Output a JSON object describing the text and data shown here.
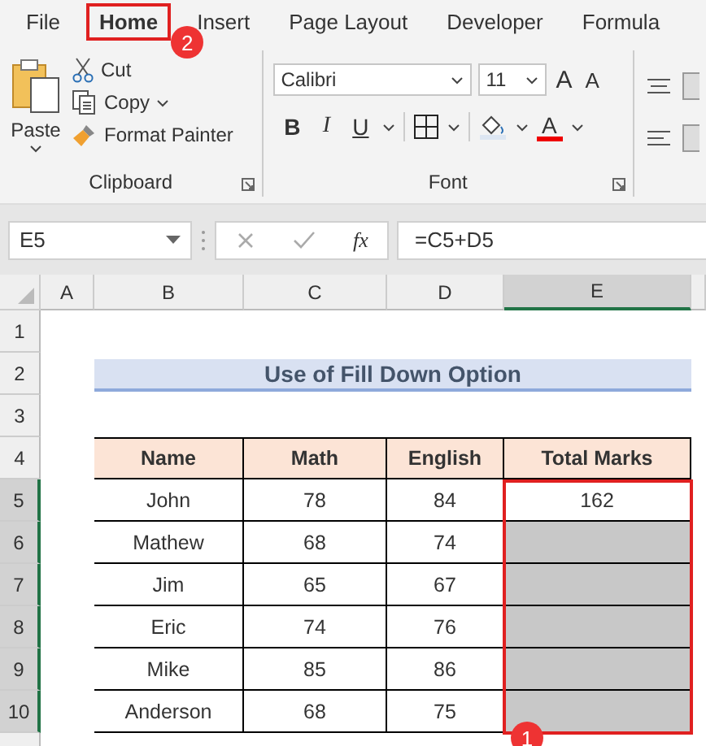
{
  "tabs": [
    {
      "label": "File",
      "selected": false
    },
    {
      "label": "Home",
      "selected": true
    },
    {
      "label": "Insert",
      "selected": false
    },
    {
      "label": "Page Layout",
      "selected": false
    },
    {
      "label": "Developer",
      "selected": false
    },
    {
      "label": "Formula",
      "selected": false
    }
  ],
  "tab_badge": "2",
  "clipboard": {
    "paste": "Paste",
    "items": [
      {
        "label": "Cut",
        "kind": "cut"
      },
      {
        "label": "Copy",
        "kind": "copy"
      },
      {
        "label": "Format Painter",
        "kind": "painter"
      }
    ],
    "group_label": "Clipboard"
  },
  "font": {
    "name": "Calibri",
    "size": "11",
    "size_buttons": [
      {
        "label": "A",
        "kind": "grow"
      },
      {
        "label": "A",
        "kind": "shrink"
      }
    ],
    "format_buttons": [
      {
        "label": "B",
        "kind": "bold"
      },
      {
        "label": "I",
        "kind": "italic"
      },
      {
        "label": "U",
        "kind": "underline"
      },
      {
        "kind": "borders"
      },
      {
        "kind": "fill"
      },
      {
        "label": "A",
        "kind": "color"
      }
    ],
    "group_label": "Font"
  },
  "name_box": "E5",
  "function_label": "fx",
  "formula": "=C5+D5",
  "columns": [
    {
      "label": "A",
      "selected": false
    },
    {
      "label": "B",
      "selected": false
    },
    {
      "label": "C",
      "selected": false
    },
    {
      "label": "D",
      "selected": false
    },
    {
      "label": "E",
      "selected": true
    }
  ],
  "row_headers": [
    {
      "label": "1",
      "selected": false
    },
    {
      "label": "2",
      "selected": false
    },
    {
      "label": "3",
      "selected": false
    },
    {
      "label": "4",
      "selected": false
    },
    {
      "label": "5",
      "selected": true
    },
    {
      "label": "6",
      "selected": true
    },
    {
      "label": "7",
      "selected": true
    },
    {
      "label": "8",
      "selected": true
    },
    {
      "label": "9",
      "selected": true
    },
    {
      "label": "10",
      "selected": true
    }
  ],
  "title": "Use of Fill Down Option",
  "table": {
    "columns": [
      "Name",
      "Math",
      "English",
      "Total Marks"
    ],
    "rows": [
      {
        "name": "John",
        "math": "78",
        "english": "84",
        "total": "162",
        "selected": true,
        "active": true
      },
      {
        "name": "Mathew",
        "math": "68",
        "english": "74",
        "selected": true,
        "active": false
      },
      {
        "name": "Jim",
        "math": "65",
        "english": "67",
        "selected": true,
        "active": false
      },
      {
        "name": "Eric",
        "math": "74",
        "english": "76",
        "selected": true,
        "active": false
      },
      {
        "name": "Mike",
        "math": "85",
        "english": "86",
        "selected": true,
        "active": false
      },
      {
        "name": "Anderson",
        "math": "68",
        "english": "75",
        "selected": true,
        "active": false
      }
    ]
  },
  "selection_badge": "1"
}
